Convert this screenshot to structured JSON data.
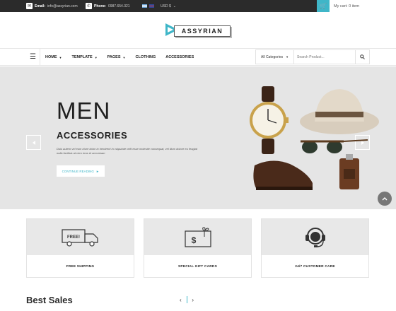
{
  "topbar": {
    "email_label": "Email:",
    "email_value": "info@assyrian.com",
    "phone_label": "Phone:",
    "phone_value": "0987.654.321",
    "currency": "USD $",
    "cart_text": "My cart: 0 item"
  },
  "logo": {
    "text": "ASSYRIAN"
  },
  "nav": {
    "items": [
      {
        "label": "HOME",
        "has_caret": true
      },
      {
        "label": "TEMPLATE",
        "has_caret": true
      },
      {
        "label": "PAGES",
        "has_caret": true
      },
      {
        "label": "CLOTHING",
        "has_caret": false
      },
      {
        "label": "ACCESSORIES",
        "has_caret": false
      }
    ],
    "category_select": "All Categories",
    "search_placeholder": "Search Product..."
  },
  "hero": {
    "title": "MEN",
    "subtitle": "ACCESSORIES",
    "body": "Duis autem vel eum iriure dolor in hendrerit in vulputate velit esse molestie consequat, vel illum dolore eu feugiat nulla facilisis at vero eros et accumsan",
    "cta": "CONTINUE READING"
  },
  "features": [
    {
      "label": "FREE SHIPPING",
      "icon": "truck-icon",
      "icon_text": "FREE!"
    },
    {
      "label": "SPECIAL GIFT CARDS",
      "icon": "gift-card-icon",
      "icon_text": "$"
    },
    {
      "label": "24/7 CUSTOMER CARE",
      "icon": "headset-icon"
    }
  ],
  "section": {
    "title": "Best Sales"
  },
  "colors": {
    "accent": "#3fb6c8",
    "topbar": "#2b2b2b",
    "hero_bg": "#e5e5e5"
  }
}
